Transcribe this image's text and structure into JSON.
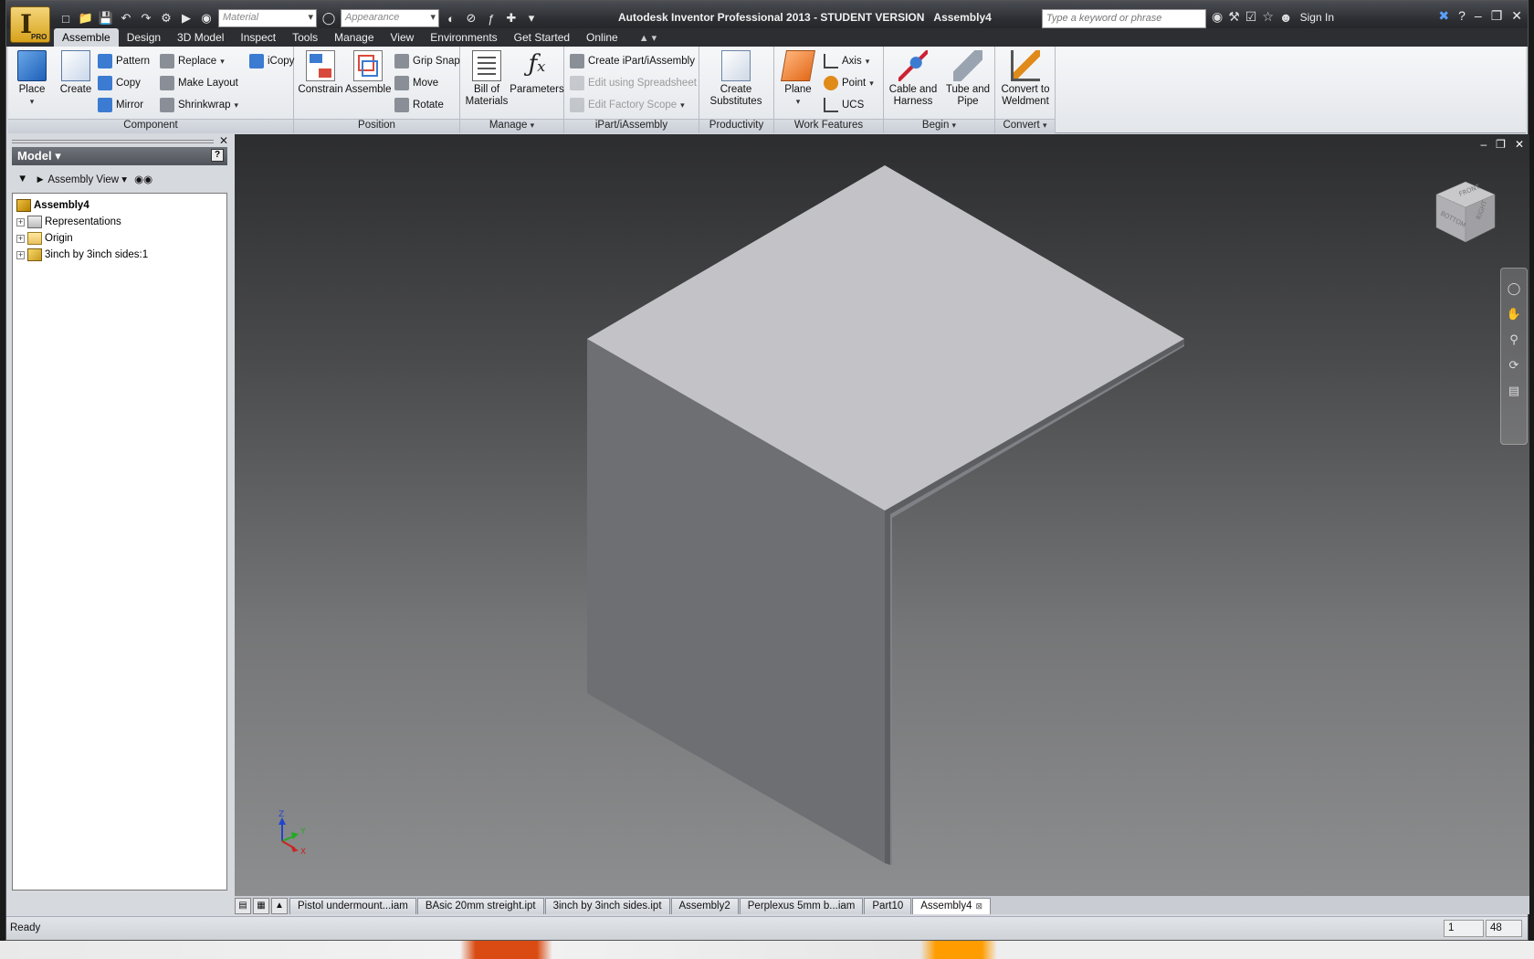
{
  "title": {
    "app_name": "Autodesk Inventor Professional 2013 - STUDENT VERSION",
    "document": "Assembly4"
  },
  "app_button": {
    "letter": "I",
    "badge": "PRO"
  },
  "quick_access": {
    "material_placeholder": "Material",
    "appearance_placeholder": "Appearance"
  },
  "search": {
    "placeholder": "Type a keyword or phrase"
  },
  "sign_in": "Sign In",
  "ribbon_tabs": [
    "Assemble",
    "Design",
    "3D Model",
    "Inspect",
    "Tools",
    "Manage",
    "View",
    "Environments",
    "Get Started",
    "Online"
  ],
  "active_tab": "Assemble",
  "ribbon": {
    "component": {
      "title": "Component",
      "place": "Place",
      "create": "Create",
      "pattern": "Pattern",
      "copy": "Copy",
      "mirror": "Mirror",
      "replace": "Replace",
      "make_layout": "Make Layout",
      "shrinkwrap": "Shrinkwrap",
      "icopy": "iCopy"
    },
    "position": {
      "title": "Position",
      "constrain": "Constrain",
      "assemble": "Assemble",
      "grip_snap": "Grip Snap",
      "move": "Move",
      "rotate": "Rotate"
    },
    "manage": {
      "title": "Manage",
      "bom_line1": "Bill of",
      "bom_line2": "Materials",
      "parameters": "Parameters"
    },
    "ipart": {
      "title": "iPart/iAssembly",
      "create": "Create iPart/iAssembly",
      "edit_spreadsheet": "Edit using Spreadsheet",
      "edit_factory_scope": "Edit Factory Scope"
    },
    "productivity": {
      "title": "Productivity",
      "line1": "Create",
      "line2": "Substitutes"
    },
    "work_features": {
      "title": "Work Features",
      "plane": "Plane",
      "axis": "Axis",
      "point": "Point",
      "ucs": "UCS"
    },
    "begin": {
      "title": "Begin",
      "cable_line1": "Cable and",
      "cable_line2": "Harness",
      "tube_line1": "Tube and",
      "tube_line2": "Pipe"
    },
    "convert": {
      "title": "Convert",
      "line1": "Convert to",
      "line2": "Weldment"
    }
  },
  "browser": {
    "header": "Model",
    "view_label": "Assembly View",
    "tree": [
      {
        "label": "Assembly4",
        "bold": true,
        "icon": "assembly-icon"
      },
      {
        "label": "Representations",
        "icon": "representations-icon"
      },
      {
        "label": "Origin",
        "icon": "folder-icon"
      },
      {
        "label": "3inch by 3inch sides:1",
        "icon": "part-icon"
      }
    ]
  },
  "viewcube": {
    "front": "FRONT",
    "right": "RIGHT",
    "bottom": "BOTTOM"
  },
  "triad": {
    "x": "X",
    "y": "Y",
    "z": "Z"
  },
  "doc_tabs": [
    "Pistol undermount...iam",
    "BAsic 20mm streight.ipt",
    "3inch by 3inch sides.ipt",
    "Assembly2",
    "Perplexus 5mm b...iam",
    "Part10",
    "Assembly4"
  ],
  "active_doc_tab": "Assembly4",
  "status": {
    "text": "Ready",
    "cell1": "1",
    "cell2": "48"
  },
  "colors": {
    "title_bar": "#2b2d31",
    "ribbon_bg": "#e3e6ea",
    "viewport_top": "#2c2d2f",
    "viewport_bottom": "#8d8e8f",
    "cube_top": "#c4c4c8",
    "cube_left": "#707175",
    "cube_right": "#5f6064"
  }
}
